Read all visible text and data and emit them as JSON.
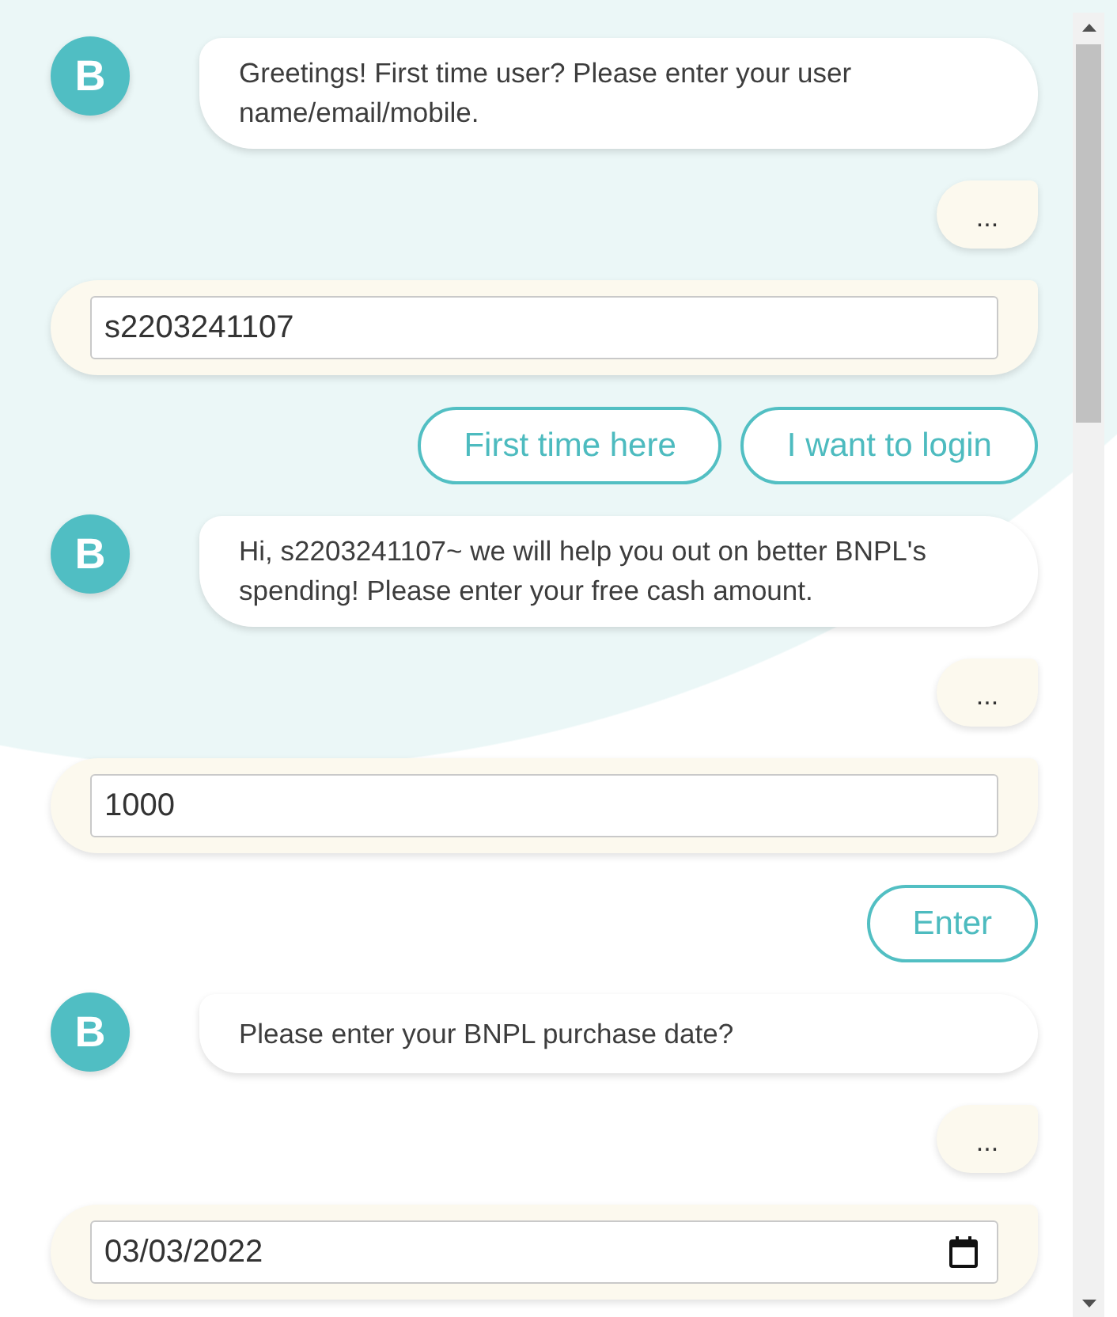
{
  "messages": [
    {
      "kind": "bot",
      "avatar": "B",
      "text": "Greetings! First time user? Please enter your user name/email/mobile."
    },
    {
      "kind": "typing",
      "text": "..."
    },
    {
      "kind": "input",
      "value": "s2203241107"
    },
    {
      "kind": "choices",
      "buttons": [
        "First time here",
        "I want to login"
      ]
    },
    {
      "kind": "bot",
      "avatar": "B",
      "text": "Hi, s2203241107~ we will help you out on better BNPL's spending! Please enter your free cash amount."
    },
    {
      "kind": "typing",
      "text": "..."
    },
    {
      "kind": "input",
      "value": "1000"
    },
    {
      "kind": "choices",
      "buttons": [
        "Enter"
      ]
    },
    {
      "kind": "bot",
      "avatar": "B",
      "text": "Please enter your BNPL purchase date?"
    },
    {
      "kind": "typing",
      "text": "..."
    },
    {
      "kind": "date_input",
      "value": "03/03/2022"
    }
  ]
}
